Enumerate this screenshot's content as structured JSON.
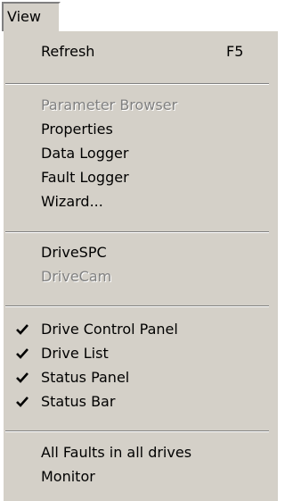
{
  "menubar": {
    "title": "View"
  },
  "menu": {
    "refresh": {
      "label": "Refresh",
      "shortcut": "F5"
    },
    "parameter_browser": {
      "label": "Parameter Browser"
    },
    "properties": {
      "label": "Properties"
    },
    "data_logger": {
      "label": "Data Logger"
    },
    "fault_logger": {
      "label": "Fault Logger"
    },
    "wizard": {
      "label": "Wizard..."
    },
    "drivespc": {
      "label": "DriveSPC"
    },
    "drivecam": {
      "label": "DriveCam"
    },
    "drive_control_panel": {
      "label": "Drive Control Panel",
      "checked": true
    },
    "drive_list": {
      "label": "Drive List",
      "checked": true
    },
    "status_panel": {
      "label": "Status Panel",
      "checked": true
    },
    "status_bar": {
      "label": "Status Bar",
      "checked": true
    },
    "all_faults": {
      "label": "All Faults in all drives"
    },
    "monitor": {
      "label": "Monitor"
    }
  },
  "colors": {
    "menu_background": "#d4d0c8",
    "disabled_text": "#808080",
    "text": "#000000"
  }
}
